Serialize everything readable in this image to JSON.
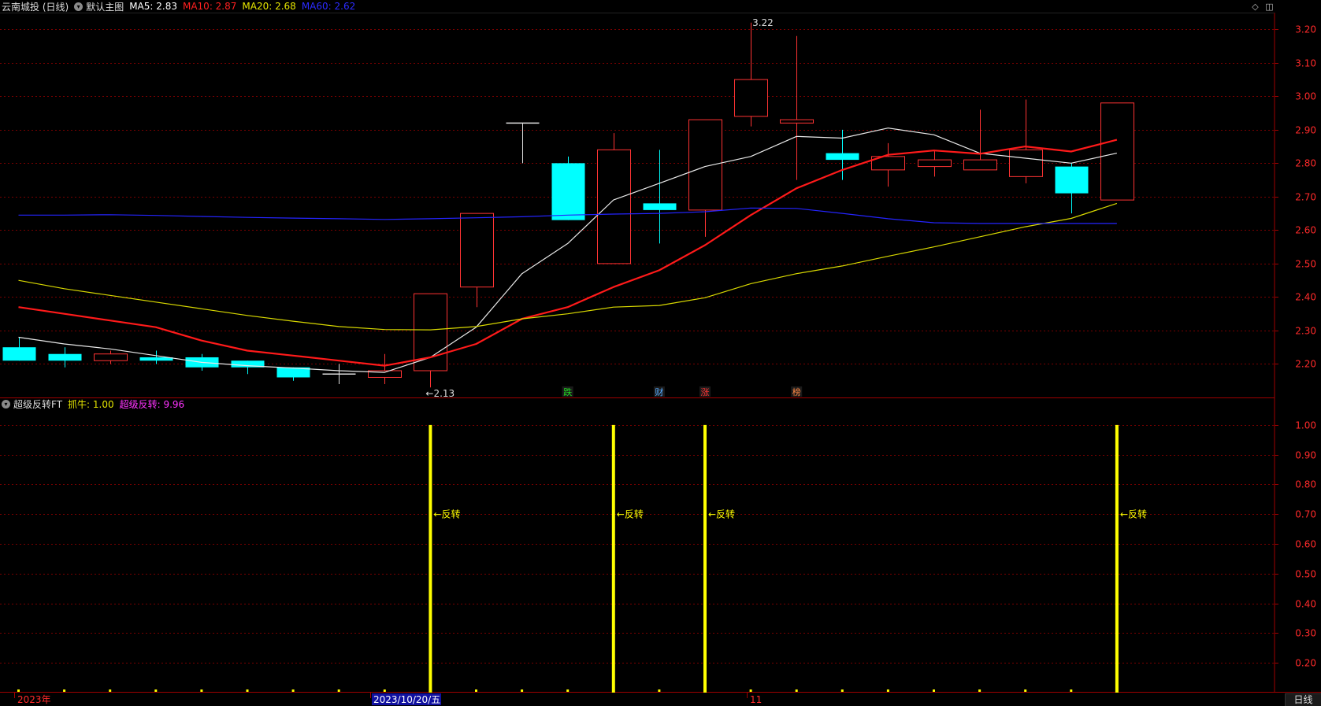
{
  "header": {
    "stock": "云南城投 (日线)",
    "template": "默认主图",
    "ma": [
      {
        "label": "MA5: 2.83",
        "color": "#ffffff"
      },
      {
        "label": "MA10: 2.87",
        "color": "#ff2020"
      },
      {
        "label": "MA20: 2.68",
        "color": "#e6e600"
      },
      {
        "label": "MA60: 2.62",
        "color": "#2b2bff"
      }
    ]
  },
  "sub_header": {
    "name": "超级反转FT",
    "items": [
      {
        "label": "抓牛: 1.00",
        "color": "#e6e600"
      },
      {
        "label": "超级反转: 9.96",
        "color": "#ff33ff"
      }
    ]
  },
  "colors": {
    "up": "#ff3333",
    "down": "#00ffff",
    "grid": "#7a0000",
    "axis": "#a00000",
    "axis_text": "#ff2a2a",
    "signal": "#ffff00"
  },
  "icons": [
    "diamond-icon",
    "window-icon",
    "collapse-icon"
  ],
  "bottom_tab": "日线",
  "chart_data": [
    {
      "type": "candlestick",
      "title": "云南城投 (日线)",
      "ylim": [
        2.1,
        3.25
      ],
      "yticks": [
        "3.20",
        "3.10",
        "3.00",
        "2.90",
        "2.80",
        "2.70",
        "2.60",
        "2.50",
        "2.40",
        "2.30",
        "2.20"
      ],
      "x_labels": [
        "2023年",
        "2023/10/20/五",
        "11"
      ],
      "candles": [
        {
          "o": 2.21,
          "c": 2.25,
          "h": 2.28,
          "l": 2.21,
          "up": false
        },
        {
          "o": 2.23,
          "c": 2.21,
          "h": 2.25,
          "l": 2.19,
          "up": false
        },
        {
          "o": 2.21,
          "c": 2.23,
          "h": 2.24,
          "l": 2.2,
          "up": true
        },
        {
          "o": 2.22,
          "c": 2.21,
          "h": 2.24,
          "l": 2.2,
          "up": false
        },
        {
          "o": 2.22,
          "c": 2.19,
          "h": 2.23,
          "l": 2.18,
          "up": false
        },
        {
          "o": 2.21,
          "c": 2.19,
          "h": 2.21,
          "l": 2.17,
          "up": false
        },
        {
          "o": 2.19,
          "c": 2.16,
          "h": 2.19,
          "l": 2.15,
          "up": false
        },
        {
          "o": 2.17,
          "c": 2.17,
          "h": 2.2,
          "l": 2.14,
          "up": false,
          "doji": true
        },
        {
          "o": 2.16,
          "c": 2.18,
          "h": 2.23,
          "l": 2.14,
          "up": true
        },
        {
          "o": 2.18,
          "c": 2.41,
          "h": 2.41,
          "l": 2.13,
          "up": true
        },
        {
          "o": 2.43,
          "c": 2.65,
          "h": 2.65,
          "l": 2.37,
          "up": true
        },
        {
          "o": 2.92,
          "c": 2.92,
          "h": 2.92,
          "l": 2.8,
          "up": true,
          "doji": true
        },
        {
          "o": 2.8,
          "c": 2.63,
          "h": 2.82,
          "l": 2.63,
          "up": false
        },
        {
          "o": 2.5,
          "c": 2.84,
          "h": 2.89,
          "l": 2.5,
          "up": true
        },
        {
          "o": 2.68,
          "c": 2.66,
          "h": 2.84,
          "l": 2.56,
          "up": false
        },
        {
          "o": 2.66,
          "c": 2.93,
          "h": 2.93,
          "l": 2.58,
          "up": true
        },
        {
          "o": 2.94,
          "c": 3.05,
          "h": 3.22,
          "l": 2.91,
          "up": true
        },
        {
          "o": 2.92,
          "c": 2.93,
          "h": 3.18,
          "l": 2.75,
          "up": true
        },
        {
          "o": 2.83,
          "c": 2.81,
          "h": 2.9,
          "l": 2.75,
          "up": false
        },
        {
          "o": 2.78,
          "c": 2.82,
          "h": 2.86,
          "l": 2.73,
          "up": true
        },
        {
          "o": 2.79,
          "c": 2.81,
          "h": 2.84,
          "l": 2.76,
          "up": true
        },
        {
          "o": 2.78,
          "c": 2.81,
          "h": 2.96,
          "l": 2.78,
          "up": true
        },
        {
          "o": 2.76,
          "c": 2.84,
          "h": 2.99,
          "l": 2.74,
          "up": true
        },
        {
          "o": 2.79,
          "c": 2.71,
          "h": 2.8,
          "l": 2.65,
          "up": false
        },
        {
          "o": 2.69,
          "c": 2.98,
          "h": 2.98,
          "l": 2.69,
          "up": true
        }
      ],
      "series": [
        {
          "name": "MA5",
          "color": "#e8e8e8",
          "width": 1.2,
          "values": [
            2.28,
            2.26,
            2.245,
            2.225,
            2.205,
            2.195,
            2.188,
            2.18,
            2.175,
            2.22,
            2.31,
            2.47,
            2.56,
            2.69,
            2.74,
            2.79,
            2.82,
            2.88,
            2.875,
            2.905,
            2.885,
            2.83,
            2.815,
            2.8,
            2.83
          ]
        },
        {
          "name": "MA10",
          "color": "#ff1a1a",
          "width": 2.2,
          "values": [
            2.37,
            2.35,
            2.33,
            2.31,
            2.27,
            2.24,
            2.225,
            2.21,
            2.195,
            2.22,
            2.26,
            2.335,
            2.37,
            2.43,
            2.48,
            2.555,
            2.645,
            2.725,
            2.78,
            2.825,
            2.838,
            2.828,
            2.85,
            2.835,
            2.87
          ]
        },
        {
          "name": "MA20",
          "color": "#d8d800",
          "width": 1.2,
          "values": [
            2.45,
            2.425,
            2.405,
            2.385,
            2.365,
            2.345,
            2.328,
            2.312,
            2.303,
            2.302,
            2.312,
            2.335,
            2.35,
            2.37,
            2.375,
            2.398,
            2.44,
            2.47,
            2.493,
            2.522,
            2.55,
            2.58,
            2.61,
            2.635,
            2.68
          ]
        },
        {
          "name": "MA60",
          "color": "#2424ff",
          "width": 1.2,
          "values": [
            2.645,
            2.645,
            2.646,
            2.644,
            2.641,
            2.638,
            2.636,
            2.634,
            2.632,
            2.634,
            2.637,
            2.64,
            2.645,
            2.648,
            2.65,
            2.655,
            2.666,
            2.665,
            2.65,
            2.634,
            2.622,
            2.62,
            2.62,
            2.62,
            2.62
          ]
        }
      ],
      "annotations": [
        {
          "text": "←2.13",
          "index": 9,
          "value": 2.13
        },
        {
          "text": "3.22",
          "index": 16,
          "value": 3.22
        },
        {
          "text": "跌",
          "index": 12,
          "color": "#22dd22"
        },
        {
          "text": "财",
          "index": 14,
          "color": "#55aaff"
        },
        {
          "text": "涨",
          "index": 15,
          "color": "#ff3333"
        },
        {
          "text": "榜",
          "index": 17,
          "color": "#ff8844"
        }
      ]
    },
    {
      "type": "bar",
      "title": "超级反转FT",
      "ylim": [
        0.1,
        1.05
      ],
      "yticks": [
        "1.00",
        "0.90",
        "0.80",
        "0.70",
        "0.60",
        "0.50",
        "0.40",
        "0.30",
        "0.20"
      ],
      "signal_indices": [
        9,
        13,
        15,
        24
      ],
      "signal_value": 1.0,
      "signal_label": "←反转",
      "signal_label_value": 0.7
    }
  ]
}
